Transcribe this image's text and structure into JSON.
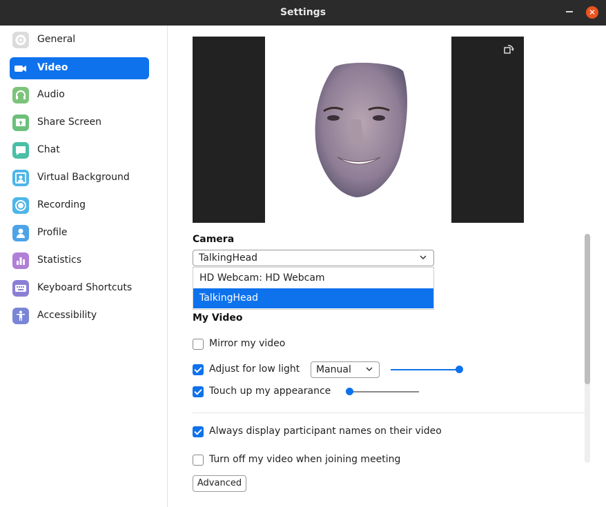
{
  "window": {
    "title": "Settings"
  },
  "sidebar": {
    "items": [
      {
        "label": "General",
        "icon": "gear-icon",
        "color": "#d9d9d9"
      },
      {
        "label": "Video",
        "icon": "video-camera-icon",
        "color": "#0e72ed",
        "active": true
      },
      {
        "label": "Audio",
        "icon": "headphones-icon",
        "color": "#7cc47a"
      },
      {
        "label": "Share Screen",
        "icon": "share-screen-icon",
        "color": "#6cc07a"
      },
      {
        "label": "Chat",
        "icon": "chat-bubble-icon",
        "color": "#4bbfa6"
      },
      {
        "label": "Virtual Background",
        "icon": "virtual-background-icon",
        "color": "#4db6e8"
      },
      {
        "label": "Recording",
        "icon": "recording-icon",
        "color": "#4db6e8"
      },
      {
        "label": "Profile",
        "icon": "profile-icon",
        "color": "#4da3e8"
      },
      {
        "label": "Statistics",
        "icon": "statistics-icon",
        "color": "#b07fd6"
      },
      {
        "label": "Keyboard Shortcuts",
        "icon": "keyboard-icon",
        "color": "#8a7fd6"
      },
      {
        "label": "Accessibility",
        "icon": "accessibility-icon",
        "color": "#7b85d6"
      }
    ]
  },
  "camera": {
    "heading": "Camera",
    "selected": "TalkingHead",
    "options": [
      "HD Webcam: HD Webcam",
      "TalkingHead"
    ]
  },
  "my_video": {
    "heading": "My Video",
    "mirror": {
      "label": "Mirror my video",
      "checked": false
    },
    "low_light": {
      "label": "Adjust for low light",
      "checked": true,
      "mode": "Manual",
      "level": 1.0
    },
    "touch_up": {
      "label": "Touch up my appearance",
      "checked": true,
      "level": 0.0
    },
    "names": {
      "label": "Always display participant names on their video",
      "checked": true
    },
    "turn_off": {
      "label": "Turn off my video when joining meeting",
      "checked": false
    }
  },
  "advanced_label": "Advanced"
}
